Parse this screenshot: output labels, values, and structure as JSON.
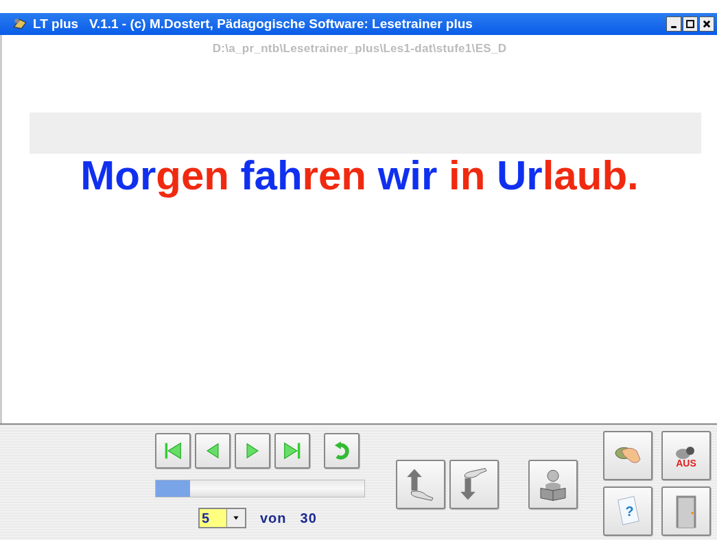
{
  "window": {
    "title": "LT plus   V.1.1 - (c) M.Dostert, Pädagogische Software: Lesetrainer plus"
  },
  "path": "D:\\a_pr_ntb\\Lesetrainer_plus\\Les1-dat\\stufe1\\ES_D",
  "sentence": [
    {
      "text": "Mor",
      "color": "#1030f0"
    },
    {
      "text": "gen",
      "color": "#f02a10"
    },
    {
      "text": " fah",
      "color": "#1030f0"
    },
    {
      "text": "ren",
      "color": "#f02a10"
    },
    {
      "text": " wir",
      "color": "#1030f0"
    },
    {
      "text": " in",
      "color": "#f02a10"
    },
    {
      "text": " Ur",
      "color": "#1030f0"
    },
    {
      "text": "laub.",
      "color": "#f02a10"
    }
  ],
  "progress": {
    "level": 0.165
  },
  "page_select": {
    "value": "5",
    "of_label": "von",
    "total": "30"
  },
  "switch_label": "AUS",
  "help_mark": "?"
}
